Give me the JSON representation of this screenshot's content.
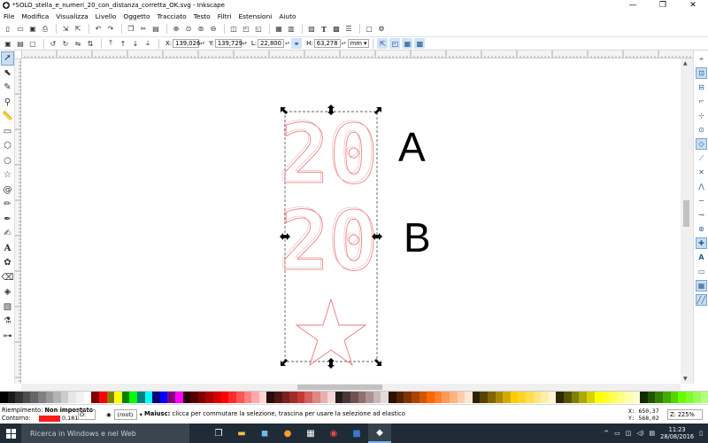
{
  "window": {
    "title": "*SOLO_stella_e_numeri_20_con_distanza_corretta_OK.svg - Inkscape",
    "buttons": [
      "—",
      "❐",
      "✕"
    ]
  },
  "menu": [
    "File",
    "Modifica",
    "Visualizza",
    "Livello",
    "Oggetto",
    "Tracciato",
    "Testo",
    "Filtri",
    "Estensioni",
    "Aiuto"
  ],
  "toolbar2": {
    "x_label": "X:",
    "x_value": "139,026",
    "y_label": "Y:",
    "y_value": "139,729",
    "w_label": "L:",
    "w_value": "22,800",
    "h_label": "H:",
    "h_value": "63,278",
    "unit": "mm"
  },
  "canvas": {
    "label_a": "A",
    "label_b": "B",
    "number_a": "20",
    "number_b": "20"
  },
  "status": {
    "fill_label": "Riempimento:",
    "fill_value": "Non impostato",
    "stroke_label": "Contorno:",
    "stroke_width": "0,181",
    "opacity_label": "O:",
    "opacity_value": "",
    "layer_value": "(root)",
    "message_bold": "Maiusc:",
    "message": " clicca per commutare la selezione, trascina per usare la selezione ad elastico",
    "x_coord": "X:   650,37",
    "y_coord": "Y:   568,02",
    "zoom_label": "Z:",
    "zoom_value": "225%"
  },
  "taskbar": {
    "search_placeholder": "Ricerca in Windows e nel Web",
    "time": "11:23",
    "date": "28/08/2016"
  },
  "colors": {
    "stroke_red": "#e87878",
    "selection": "#333333",
    "accent": "#c8ddf2"
  },
  "palette": [
    "#000000",
    "#1a1a1a",
    "#333333",
    "#4d4d4d",
    "#666666",
    "#808080",
    "#999999",
    "#b3b3b3",
    "#cccccc",
    "#e6e6e6",
    "#f2f2f2",
    "#ffffff",
    "#800000",
    "#ff0000",
    "#808000",
    "#ffff00",
    "#008000",
    "#00ff00",
    "#008080",
    "#00ffff",
    "#000080",
    "#0000ff",
    "#800080",
    "#ff00ff",
    "#2b0000",
    "#550000",
    "#800000",
    "#aa0000",
    "#d40000",
    "#ff0000",
    "#ff2a2a",
    "#ff5555",
    "#ff8080",
    "#ffaaaa",
    "#ffd5d5",
    "#280b0b",
    "#501616",
    "#782121",
    "#a02c2c",
    "#c83737",
    "#d35f5f",
    "#de8787",
    "#e9afaf",
    "#f4d7d7",
    "#241c1c",
    "#483737",
    "#6c5353",
    "#916f6f",
    "#ac9393",
    "#c8b7b7",
    "#e3dbdb",
    "#2b1100",
    "#552200",
    "#803300",
    "#aa4400",
    "#d45500",
    "#ff6600",
    "#ff7f2a",
    "#ff9955",
    "#ffb380",
    "#ffccaa",
    "#ffe6d5",
    "#2b2200",
    "#554400",
    "#806600",
    "#aa8800",
    "#d4aa00",
    "#ffcc00",
    "#ffd42a",
    "#ffdd55",
    "#ffe680",
    "#ffeeaa",
    "#fff6d5",
    "#2b2b00",
    "#555500",
    "#808000",
    "#aaaa00",
    "#d4d400",
    "#ffff00",
    "#ffff2a",
    "#ffff55",
    "#ffff80",
    "#ffffaa",
    "#ffffd5",
    "#112b00",
    "#225500",
    "#338000",
    "#44aa00",
    "#55d400",
    "#66ff00",
    "#7fff2a",
    "#99ff55",
    "#b3ff80"
  ]
}
